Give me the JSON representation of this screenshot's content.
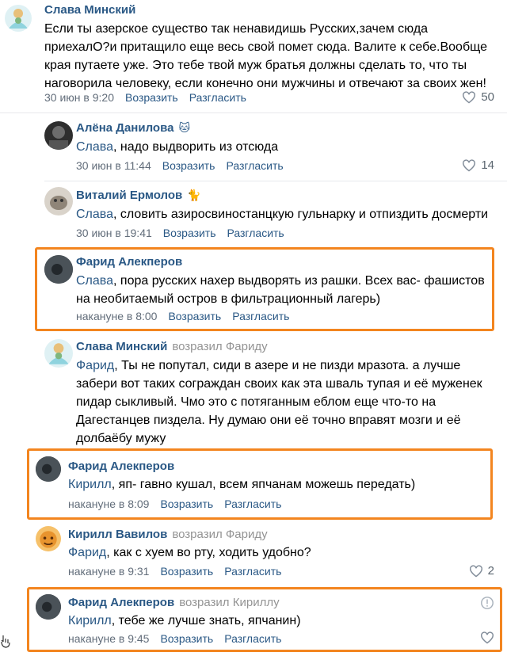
{
  "comments": [
    {
      "author": "Слава Минский",
      "text": "Если ты азерское существо так ненавидишь Русских,зачем сюда приехалО?и притащило еще весь свой помет сюда. Валите к себе.Вообще края путаете уже. Это тебе твой муж братья должны сделать то, что ты наговорила человеку, если конечно они мужчины и отвечают за своих жен!",
      "time": "30 июн в 9:20",
      "reply": "Возразить",
      "disagree": "Разгласить",
      "likes": "50"
    },
    {
      "author": "Алёна Данилова",
      "addressee": "Слава",
      "text": ", надо выдворить из отсюда",
      "time": "30 июн в 11:44",
      "reply": "Возразить",
      "disagree": "Разгласить",
      "likes": "14"
    },
    {
      "author": "Виталий Ермолов",
      "addressee": "Слава",
      "text": ", словить азиросвиностанцкую гульнарку и отпиздить досмерти",
      "time": "30 июн в 19:41",
      "reply": "Возразить",
      "disagree": "Разгласить"
    },
    {
      "author": "Фарид Алекперов",
      "addressee": "Слава",
      "text": ", пора русских нахер выдворять из рашки. Всех вас- фашистов на необитаемый остров в фильтрационный лагерь)",
      "time": "накануне в 8:00",
      "reply": "Возразить",
      "disagree": "Разгласить"
    },
    {
      "author": "Слава Минский",
      "replied": "возразил Фариду",
      "addressee": "Фарид",
      "text": ", Ты не попутал, сиди в азере и не пизди мразота. а лучше забери вот таких сограждан своих как эта шваль тупая и её муженек пидар сыкливый. Чмо это с потяганным еблом еще что-то на Дагестанцев пиздела. Ну думаю они её точно вправят мозги и её долбаёбу мужу"
    },
    {
      "author": "Фарид Алекперов",
      "addressee": "Кирилл",
      "text": ", яп- гавно кушал, всем япчанам можешь передать)",
      "time": "накануне в 8:09",
      "reply": "Возразить",
      "disagree": "Разгласить"
    },
    {
      "author": "Кирилл Вавилов",
      "replied": "возразил Фариду",
      "addressee": "Фарид",
      "text": ", как с хуем во рту, ходить удобно?",
      "time": "накануне в 9:31",
      "reply": "Возразить",
      "disagree": "Разгласить",
      "likes": "2"
    },
    {
      "author": "Фарид Алекперов",
      "replied": "возразил Кириллу",
      "addressee": "Кирилл",
      "text": ", тебе же лучше знать, япчанин)",
      "time": "накануне в 9:45",
      "reply": "Возразить",
      "disagree": "Разгласить"
    }
  ],
  "icons": {
    "like": "heart-outline-icon",
    "report": "exclamation-circle-icon"
  },
  "colors": {
    "link": "#2a5885",
    "meta": "#626d7a",
    "highlight": "#f3851f"
  }
}
